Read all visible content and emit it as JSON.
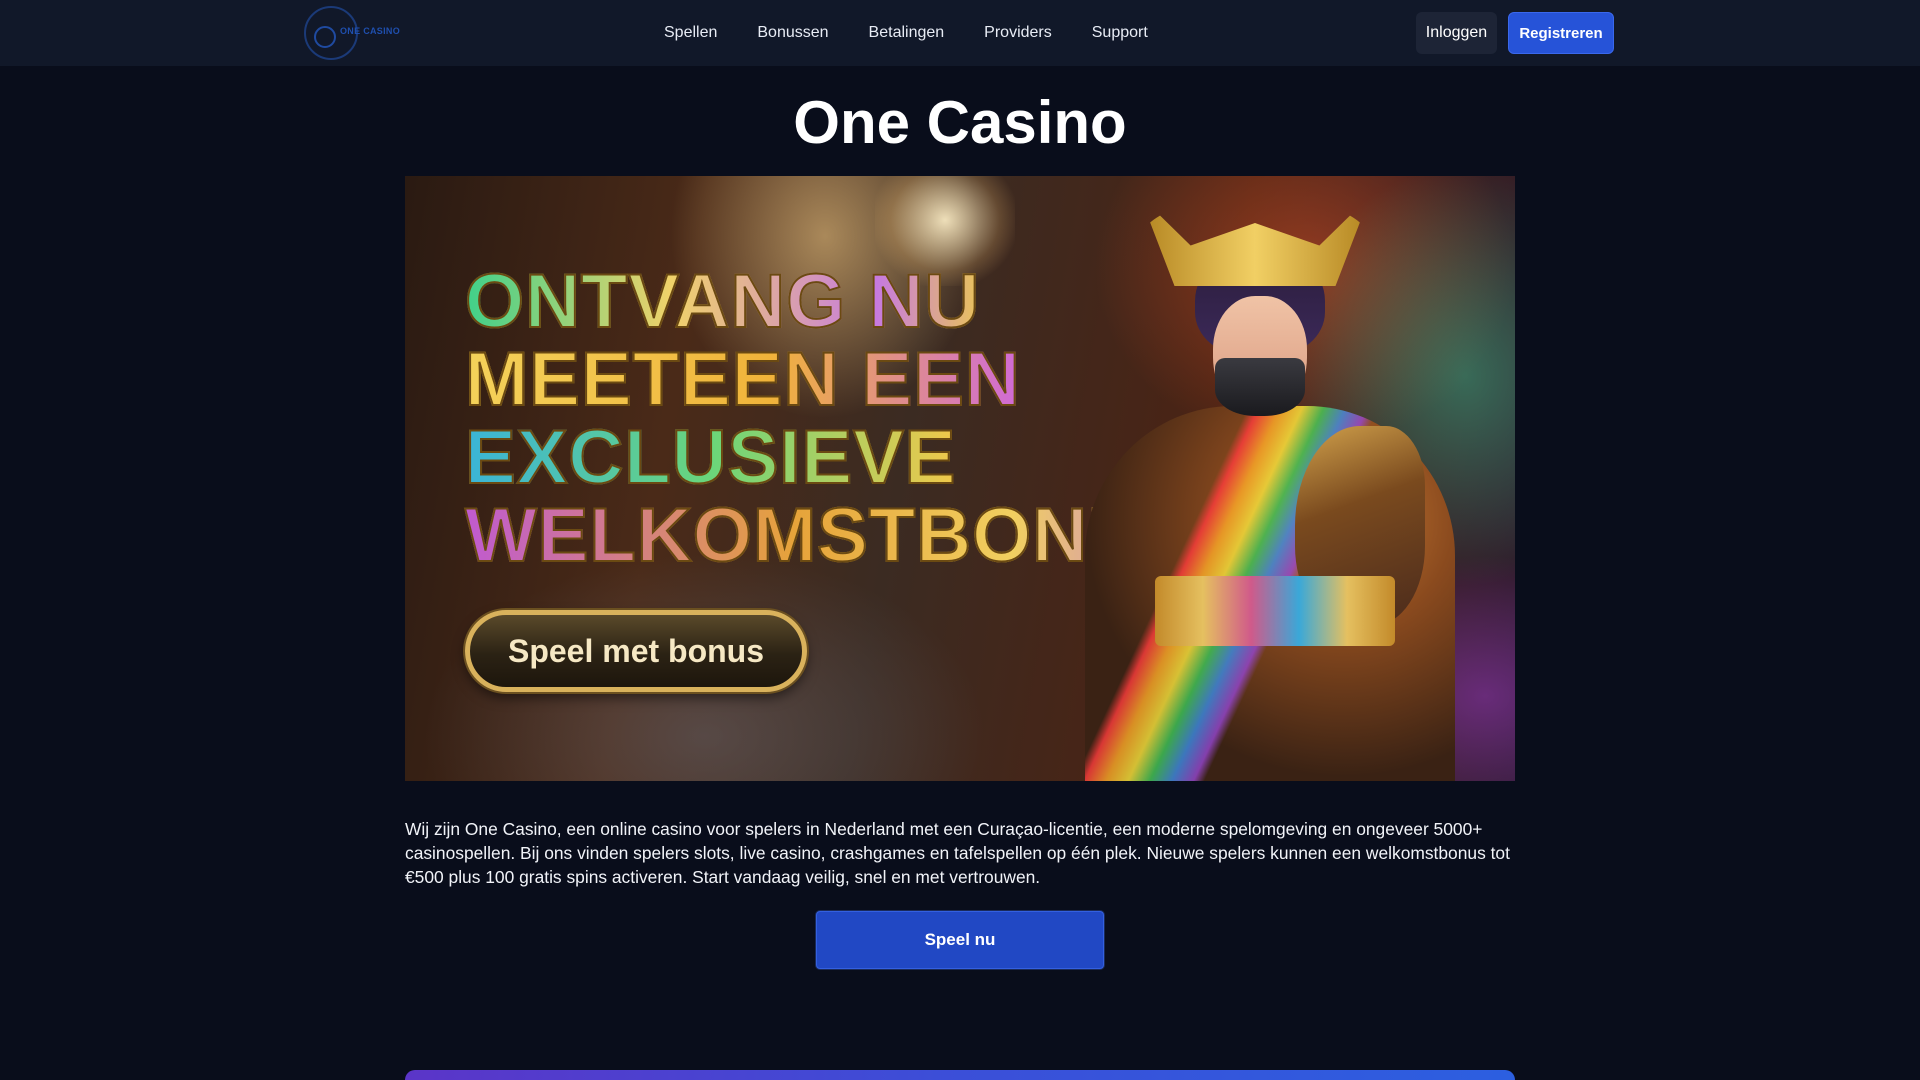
{
  "header": {
    "logo_text": "ONE CASINO",
    "nav": [
      "Spellen",
      "Bonussen",
      "Betalingen",
      "Providers",
      "Support"
    ],
    "login_label": "Inloggen",
    "register_label": "Registreren"
  },
  "main": {
    "title": "One Casino",
    "hero": {
      "headline": [
        "ONTVANG NU",
        "MEETEEN EEN",
        "EXCLUSIEVE",
        "WELKOMSTBONUS"
      ],
      "cta_label": "Speel met bonus"
    },
    "description": "Wij zijn One Casino, een online casino voor spelers in Nederland met een Curaçao-licentie, een moderne spelomgeving en ongeveer 5000+ casinospellen. Bij ons vinden spelers slots, live casino, crashgames en tafelspellen op één plek. Nieuwe spelers kunnen een welkomstbonus tot €500 plus 100 gratis spins activeren. Start vandaag veilig, snel en met vertrouwen.",
    "play_label": "Speel nu"
  },
  "colors": {
    "background": "#090d1b",
    "header_bg": "#111829",
    "accent_blue": "#2653d8"
  }
}
